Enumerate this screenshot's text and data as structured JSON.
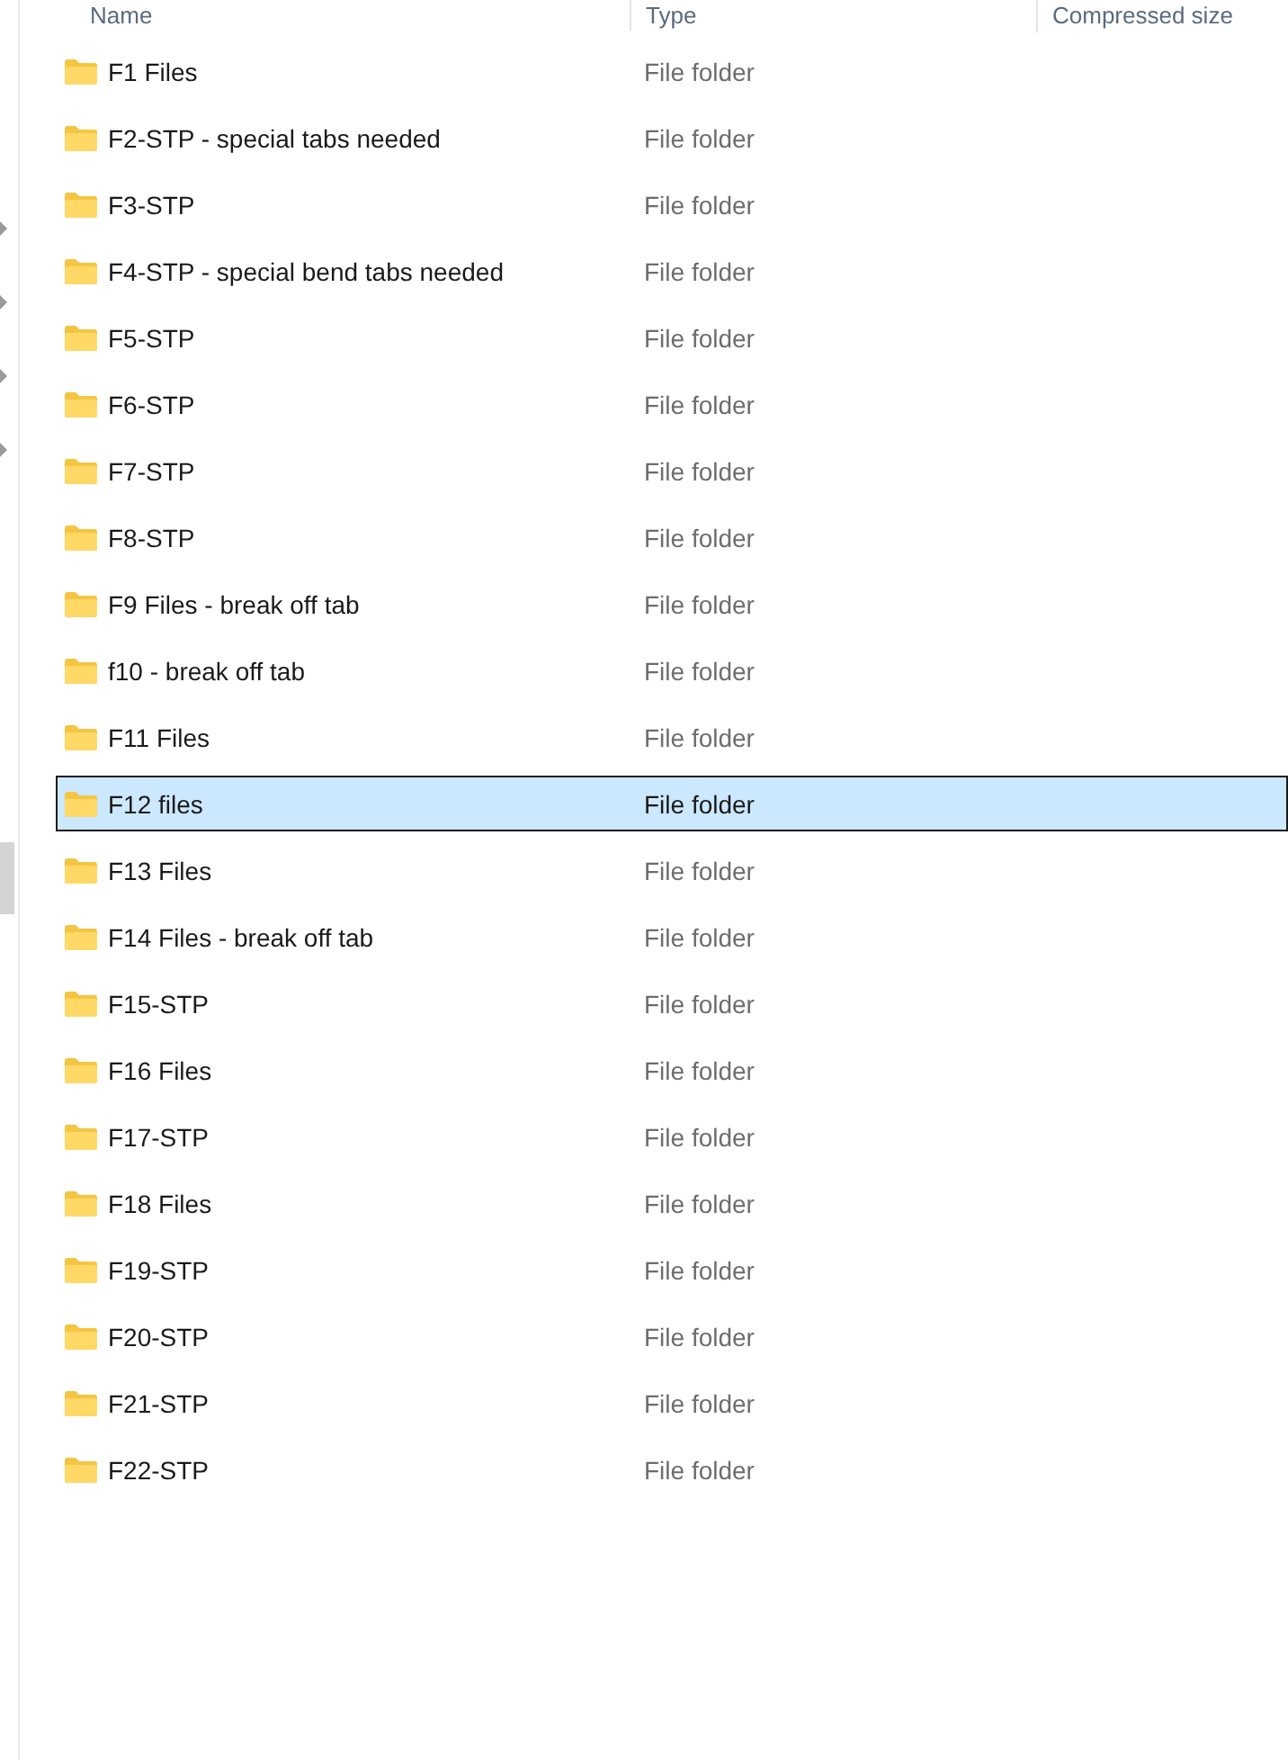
{
  "columns": [
    "Name",
    "Type",
    "Compressed size"
  ],
  "rows": [
    {
      "name": "F1 Files",
      "type": "File folder",
      "selected": false
    },
    {
      "name": "F2-STP - special tabs needed",
      "type": "File folder",
      "selected": false
    },
    {
      "name": "F3-STP",
      "type": "File folder",
      "selected": false
    },
    {
      "name": "F4-STP - special bend tabs needed",
      "type": "File folder",
      "selected": false
    },
    {
      "name": "F5-STP",
      "type": "File folder",
      "selected": false
    },
    {
      "name": "F6-STP",
      "type": "File folder",
      "selected": false
    },
    {
      "name": "F7-STP",
      "type": "File folder",
      "selected": false
    },
    {
      "name": "F8-STP",
      "type": "File folder",
      "selected": false
    },
    {
      "name": "F9 Files - break off tab",
      "type": "File folder",
      "selected": false
    },
    {
      "name": "f10 - break off tab",
      "type": "File folder",
      "selected": false
    },
    {
      "name": "F11 Files",
      "type": "File folder",
      "selected": false
    },
    {
      "name": "F12 files",
      "type": "File folder",
      "selected": true
    },
    {
      "name": "F13 Files",
      "type": "File folder",
      "selected": false
    },
    {
      "name": "F14 Files - break off tab",
      "type": "File folder",
      "selected": false
    },
    {
      "name": "F15-STP",
      "type": "File folder",
      "selected": false
    },
    {
      "name": "F16 Files",
      "type": "File folder",
      "selected": false
    },
    {
      "name": "F17-STP",
      "type": "File folder",
      "selected": false
    },
    {
      "name": "F18 Files",
      "type": "File folder",
      "selected": false
    },
    {
      "name": "F19-STP",
      "type": "File folder",
      "selected": false
    },
    {
      "name": "F20-STP",
      "type": "File folder",
      "selected": false
    },
    {
      "name": "F21-STP",
      "type": "File folder",
      "selected": false
    },
    {
      "name": "F22-STP",
      "type": "File folder",
      "selected": false
    }
  ]
}
